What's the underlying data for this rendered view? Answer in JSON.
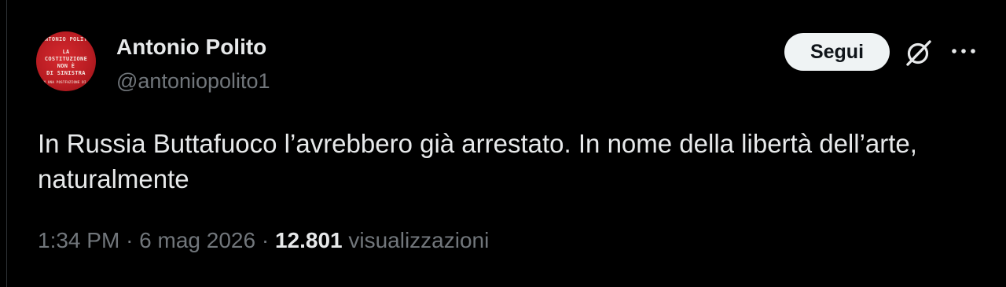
{
  "author": {
    "display_name": "Antonio Polito",
    "handle": "@antoniopolito1",
    "avatar_cover_lines": [
      "ANTONIO POLITO",
      "LA",
      "COSTITUZIONE",
      "NON È",
      "DI SINISTRA",
      "CON UNA POSTFAZIONE DI..."
    ]
  },
  "actions": {
    "follow_label": "Segui",
    "grok_icon": "grok-icon",
    "more_icon": "more-icon"
  },
  "tweet": {
    "text": "In Russia Buttafuoco l’avrebbero già arrestato. In nome della libertà dell’arte, naturalmente"
  },
  "meta": {
    "time": "1:34 PM",
    "separator": "·",
    "date": "6 mag 2026",
    "views_count": "12.801",
    "views_label": "visualizzazioni"
  },
  "colors": {
    "background": "#000000",
    "primary_text": "#e7e9ea",
    "secondary_text": "#71767b",
    "follow_button_bg": "#eff3f4",
    "avatar_red": "#c4232a"
  }
}
